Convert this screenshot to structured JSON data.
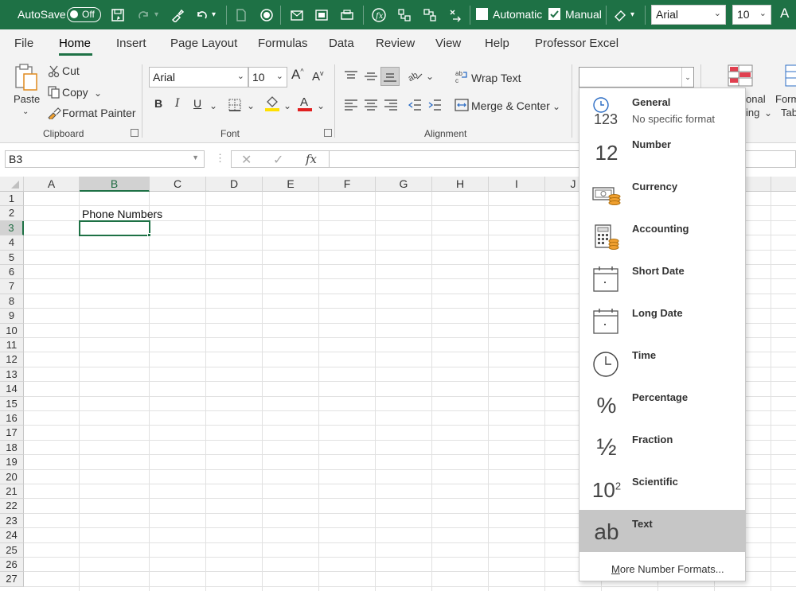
{
  "qat": {
    "autosave_label": "AutoSave",
    "autosave_state": "Off",
    "automatic_label": "Automatic",
    "manual_label": "Manual",
    "font_name": "Arial",
    "font_size": "10",
    "grow_font": "A"
  },
  "tabs": [
    "File",
    "Home",
    "Insert",
    "Page Layout",
    "Formulas",
    "Data",
    "Review",
    "View",
    "Help",
    "Professor Excel"
  ],
  "active_tab": "Home",
  "ribbon": {
    "clipboard": {
      "paste": "Paste",
      "cut": "Cut",
      "copy": "Copy",
      "format_painter": "Format Painter",
      "group_label": "Clipboard"
    },
    "font": {
      "font_name": "Arial",
      "font_size": "10",
      "bold": "B",
      "italic": "I",
      "underline": "U",
      "group_label": "Font"
    },
    "alignment": {
      "wrap_text": "Wrap Text",
      "merge_center": "Merge & Center",
      "group_label": "Alignment"
    },
    "styles": {
      "conditional_a": "onal",
      "conditional_b": "ing",
      "format_a": "Form",
      "format_b": "Tab"
    }
  },
  "formula_bar": {
    "name_box": "B3",
    "fx_label": "fx",
    "formula": ""
  },
  "sheet": {
    "columns": [
      "A",
      "B",
      "C",
      "D",
      "E",
      "F",
      "G",
      "H",
      "I",
      "J",
      "",
      "",
      "",
      "N"
    ],
    "rows": [
      "1",
      "2",
      "3",
      "4",
      "5",
      "6",
      "7",
      "8",
      "9",
      "10",
      "11",
      "12",
      "13",
      "14",
      "15",
      "16",
      "17",
      "18",
      "19",
      "20",
      "21",
      "22",
      "23",
      "24",
      "25",
      "26",
      "27"
    ],
    "selected_cell": "B3",
    "cells": {
      "B2": "Phone Numbers"
    }
  },
  "number_format_dropdown": {
    "items": [
      {
        "name": "General",
        "desc": "No specific format",
        "icon": "general-clock-123-icon",
        "glyph": "123"
      },
      {
        "name": "Number",
        "desc": "",
        "icon": "number-12-icon",
        "glyph": "12"
      },
      {
        "name": "Currency",
        "desc": "",
        "icon": "currency-icon",
        "glyph": ""
      },
      {
        "name": "Accounting",
        "desc": "",
        "icon": "accounting-calculator-icon",
        "glyph": ""
      },
      {
        "name": "Short Date",
        "desc": "",
        "icon": "calendar-icon",
        "glyph": ""
      },
      {
        "name": "Long Date",
        "desc": "",
        "icon": "calendar-icon",
        "glyph": ""
      },
      {
        "name": "Time",
        "desc": "",
        "icon": "clock-icon",
        "glyph": ""
      },
      {
        "name": "Percentage",
        "desc": "",
        "icon": "percent-icon",
        "glyph": "%"
      },
      {
        "name": "Fraction",
        "desc": "",
        "icon": "fraction-icon",
        "glyph": "½"
      },
      {
        "name": "Scientific",
        "desc": "",
        "icon": "scientific-icon",
        "glyph": "10"
      },
      {
        "name": "Text",
        "desc": "",
        "icon": "text-ab-icon",
        "glyph": "ab"
      }
    ],
    "highlighted": "Text",
    "more_formats": "More Number Formats...",
    "more_formats_accel": "M",
    "more_formats_rest": "ore Number Formats..."
  },
  "colors": {
    "excel_green": "#1e7145",
    "ribbon_bg": "#f3f3f3",
    "highlight": "#c6c6c6",
    "accent_orange": "#f0a030",
    "font_red": "#e02020",
    "fill_yellow": "#ffe000"
  }
}
